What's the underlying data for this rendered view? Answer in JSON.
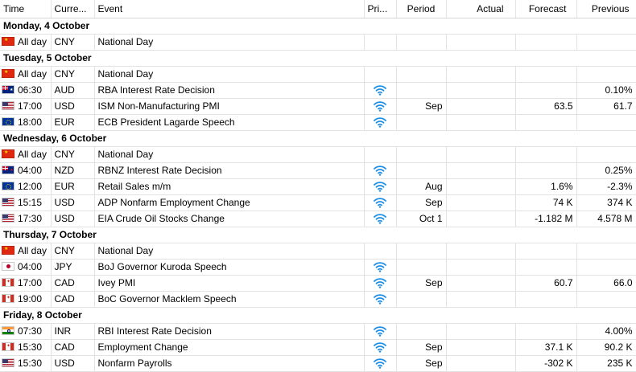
{
  "columns": {
    "time": "Time",
    "currency": "Curre...",
    "event": "Event",
    "priority": "Pri...",
    "period": "Period",
    "actual": "Actual",
    "forecast": "Forecast",
    "previous": "Previous"
  },
  "colors": {
    "priority_icon": "#1f8ee5",
    "grid": "#e2e2e2"
  },
  "days": [
    {
      "label": "Monday, 4 October",
      "rows": [
        {
          "flag": "cn",
          "time": "All day",
          "currency": "CNY",
          "event": "National Day",
          "priority": false,
          "period": "",
          "actual": "",
          "forecast": "",
          "previous": ""
        }
      ]
    },
    {
      "label": "Tuesday, 5 October",
      "rows": [
        {
          "flag": "cn",
          "time": "All day",
          "currency": "CNY",
          "event": "National Day",
          "priority": false,
          "period": "",
          "actual": "",
          "forecast": "",
          "previous": ""
        },
        {
          "flag": "au",
          "time": "06:30",
          "currency": "AUD",
          "event": "RBA Interest Rate Decision",
          "priority": true,
          "period": "",
          "actual": "",
          "forecast": "",
          "previous": "0.10%"
        },
        {
          "flag": "us",
          "time": "17:00",
          "currency": "USD",
          "event": "ISM Non-Manufacturing PMI",
          "priority": true,
          "period": "Sep",
          "actual": "",
          "forecast": "63.5",
          "previous": "61.7"
        },
        {
          "flag": "eu",
          "time": "18:00",
          "currency": "EUR",
          "event": "ECB President Lagarde Speech",
          "priority": true,
          "period": "",
          "actual": "",
          "forecast": "",
          "previous": ""
        }
      ]
    },
    {
      "label": "Wednesday, 6 October",
      "rows": [
        {
          "flag": "cn",
          "time": "All day",
          "currency": "CNY",
          "event": "National Day",
          "priority": false,
          "period": "",
          "actual": "",
          "forecast": "",
          "previous": ""
        },
        {
          "flag": "nz",
          "time": "04:00",
          "currency": "NZD",
          "event": "RBNZ Interest Rate Decision",
          "priority": true,
          "period": "",
          "actual": "",
          "forecast": "",
          "previous": "0.25%"
        },
        {
          "flag": "eu",
          "time": "12:00",
          "currency": "EUR",
          "event": "Retail Sales m/m",
          "priority": true,
          "period": "Aug",
          "actual": "",
          "forecast": "1.6%",
          "previous": "-2.3%"
        },
        {
          "flag": "us",
          "time": "15:15",
          "currency": "USD",
          "event": "ADP Nonfarm Employment Change",
          "priority": true,
          "period": "Sep",
          "actual": "",
          "forecast": "74 K",
          "previous": "374 K"
        },
        {
          "flag": "us",
          "time": "17:30",
          "currency": "USD",
          "event": "EIA Crude Oil Stocks Change",
          "priority": true,
          "period": "Oct 1",
          "actual": "",
          "forecast": "-1.182 M",
          "previous": "4.578 M"
        }
      ]
    },
    {
      "label": "Thursday, 7 October",
      "rows": [
        {
          "flag": "cn",
          "time": "All day",
          "currency": "CNY",
          "event": "National Day",
          "priority": false,
          "period": "",
          "actual": "",
          "forecast": "",
          "previous": ""
        },
        {
          "flag": "jp",
          "time": "04:00",
          "currency": "JPY",
          "event": "BoJ Governor Kuroda Speech",
          "priority": true,
          "period": "",
          "actual": "",
          "forecast": "",
          "previous": ""
        },
        {
          "flag": "ca",
          "time": "17:00",
          "currency": "CAD",
          "event": "Ivey PMI",
          "priority": true,
          "period": "Sep",
          "actual": "",
          "forecast": "60.7",
          "previous": "66.0"
        },
        {
          "flag": "ca",
          "time": "19:00",
          "currency": "CAD",
          "event": "BoC Governor Macklem Speech",
          "priority": true,
          "period": "",
          "actual": "",
          "forecast": "",
          "previous": ""
        }
      ]
    },
    {
      "label": "Friday, 8 October",
      "rows": [
        {
          "flag": "in",
          "time": "07:30",
          "currency": "INR",
          "event": "RBI Interest Rate Decision",
          "priority": true,
          "period": "",
          "actual": "",
          "forecast": "",
          "previous": "4.00%"
        },
        {
          "flag": "ca",
          "time": "15:30",
          "currency": "CAD",
          "event": "Employment Change",
          "priority": true,
          "period": "Sep",
          "actual": "",
          "forecast": "37.1 K",
          "previous": "90.2 K"
        },
        {
          "flag": "us",
          "time": "15:30",
          "currency": "USD",
          "event": "Nonfarm Payrolls",
          "priority": true,
          "period": "Sep",
          "actual": "",
          "forecast": "-302 K",
          "previous": "235 K"
        }
      ]
    }
  ]
}
